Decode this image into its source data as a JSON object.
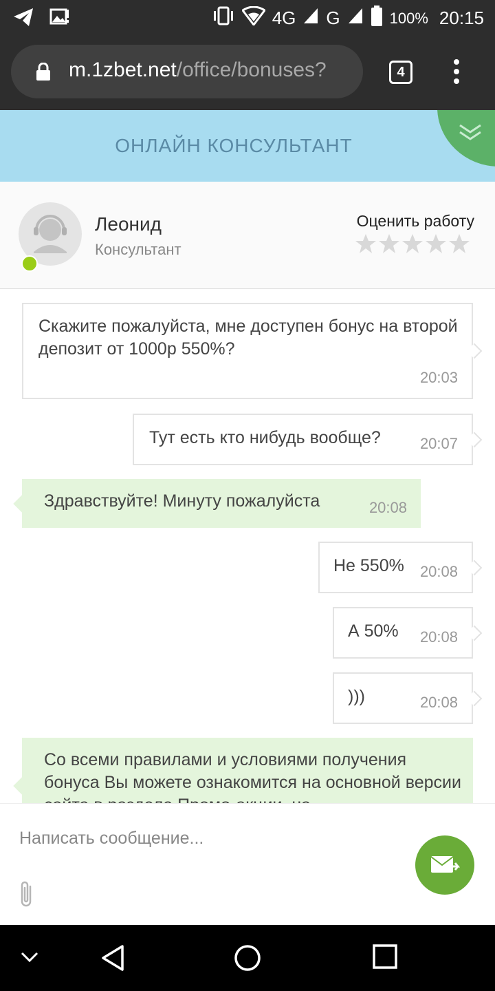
{
  "status_bar": {
    "network": "4G",
    "network2": "G",
    "battery": "100%",
    "time": "20:15",
    "icons": [
      "telegram-icon",
      "image-notification-icon",
      "vibrate-icon",
      "wifi-icon",
      "signal-icon",
      "battery-icon"
    ]
  },
  "browser": {
    "url_host": "m.1zbet.net",
    "url_path": "/office/bonuses?",
    "tab_count": "4"
  },
  "chat_header": {
    "title": "ОНЛАЙН КОНСУЛЬТАНТ"
  },
  "consultant": {
    "name": "Леонид",
    "role": "Консультант",
    "rate_label": "Оценить работу",
    "rating_stars": 5,
    "rating_value": 0
  },
  "messages": [
    {
      "sender": "user",
      "text": "Скажите пожалуйста, мне доступен бонус на второй депозит от 1000р 550%?",
      "time": "20:03"
    },
    {
      "sender": "user",
      "text": "Тут есть кто нибудь вообще?",
      "time": "20:07"
    },
    {
      "sender": "agent",
      "text": "Здравствуйте! Минуту пожалуйста",
      "time": "20:08"
    },
    {
      "sender": "user",
      "text": "Не 550%",
      "time": "20:08"
    },
    {
      "sender": "user",
      "text": "А 50%",
      "time": "20:08"
    },
    {
      "sender": "user",
      "text": ")))",
      "time": "20:08"
    },
    {
      "sender": "agent",
      "text": "Со всеми правилами и условиями получения бонуса Вы можете ознакомится на основной версии сайта в разделе Промо-акции, на",
      "time": ""
    }
  ],
  "composer": {
    "placeholder": "Написать сообщение..."
  },
  "colors": {
    "header_bg": "#a8dcf0",
    "header_text": "#5a8aa5",
    "agent_bubble": "#e4f5dc",
    "online": "#9acd17",
    "send_button": "#6aac38",
    "collapse_button": "#5cb168"
  }
}
